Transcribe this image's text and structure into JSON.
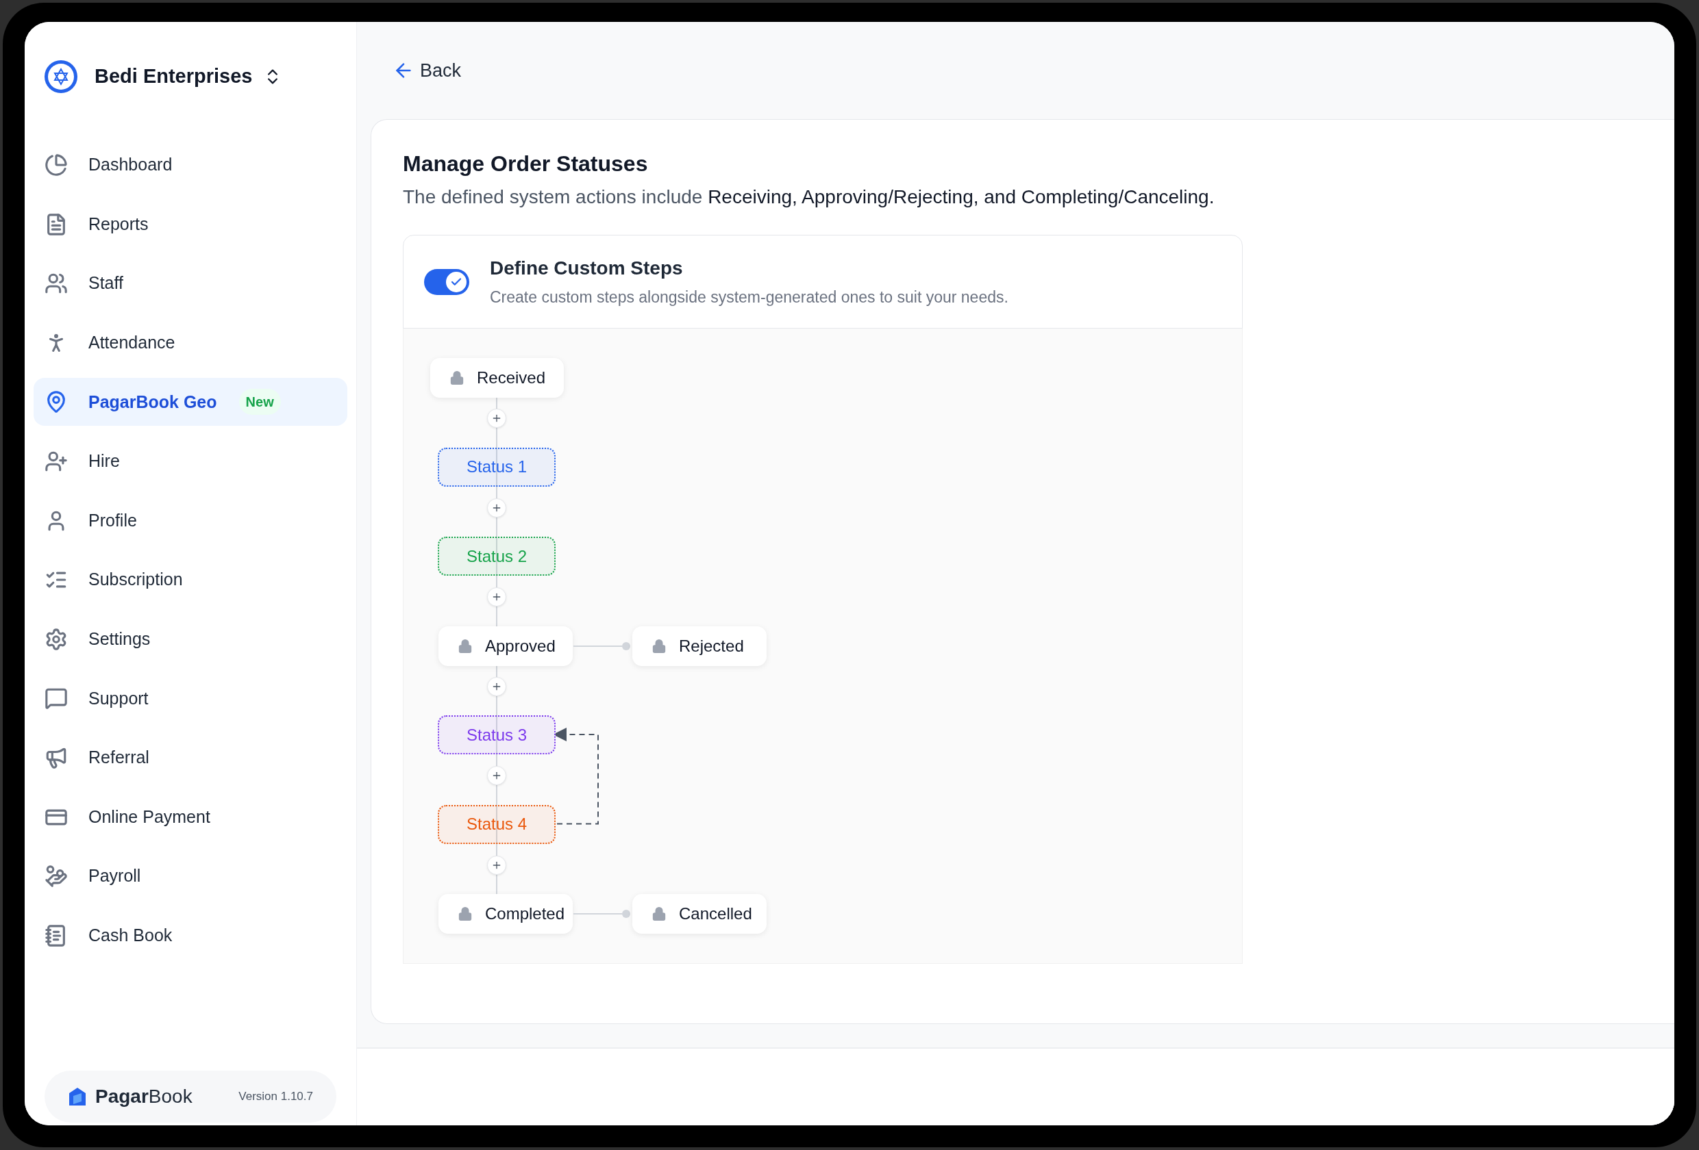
{
  "sidebar": {
    "org_name": "Bedi Enterprises",
    "items": [
      {
        "label": "Dashboard",
        "selected": false
      },
      {
        "label": "Reports",
        "selected": false
      },
      {
        "label": "Staff",
        "selected": false
      },
      {
        "label": "Attendance",
        "selected": false
      },
      {
        "label": "PagarBook Geo",
        "selected": true,
        "badge": "New"
      },
      {
        "label": "Hire",
        "selected": false
      },
      {
        "label": "Profile",
        "selected": false
      },
      {
        "label": "Subscription",
        "selected": false
      },
      {
        "label": "Settings",
        "selected": false
      },
      {
        "label": "Support",
        "selected": false
      },
      {
        "label": "Referral",
        "selected": false
      },
      {
        "label": "Online Payment",
        "selected": false
      },
      {
        "label": "Payroll",
        "selected": false
      },
      {
        "label": "Cash Book",
        "selected": false
      }
    ],
    "brand": "**Pagar**Book",
    "version": "Version 1.10.7"
  },
  "back": "Back",
  "card": {
    "title": "Manage Order Statuses",
    "description": "The defined system actions include **Receiving, Approving/Rejecting, and Completing/Canceling.**",
    "custom_steps": {
      "on": true,
      "title": "Define Custom Steps",
      "subtitle": "Create custom steps alongside system-generated ones to suit your needs."
    },
    "flow": [
      {
        "kind": "system",
        "label": "Received"
      },
      {
        "kind": "custom",
        "label": "Status 1",
        "color": "#2563eb"
      },
      {
        "kind": "custom",
        "label": "Status 2",
        "color": "#16a34a"
      },
      {
        "kind": "system",
        "label": "Approved",
        "branch": "Rejected"
      },
      {
        "kind": "custom",
        "label": "Status 3",
        "color": "#7c3aed"
      },
      {
        "kind": "custom",
        "label": "Status 4",
        "color": "#ea580c",
        "loops_back": true
      },
      {
        "kind": "system",
        "label": "Completed",
        "branch": "Cancelled"
      }
    ]
  }
}
